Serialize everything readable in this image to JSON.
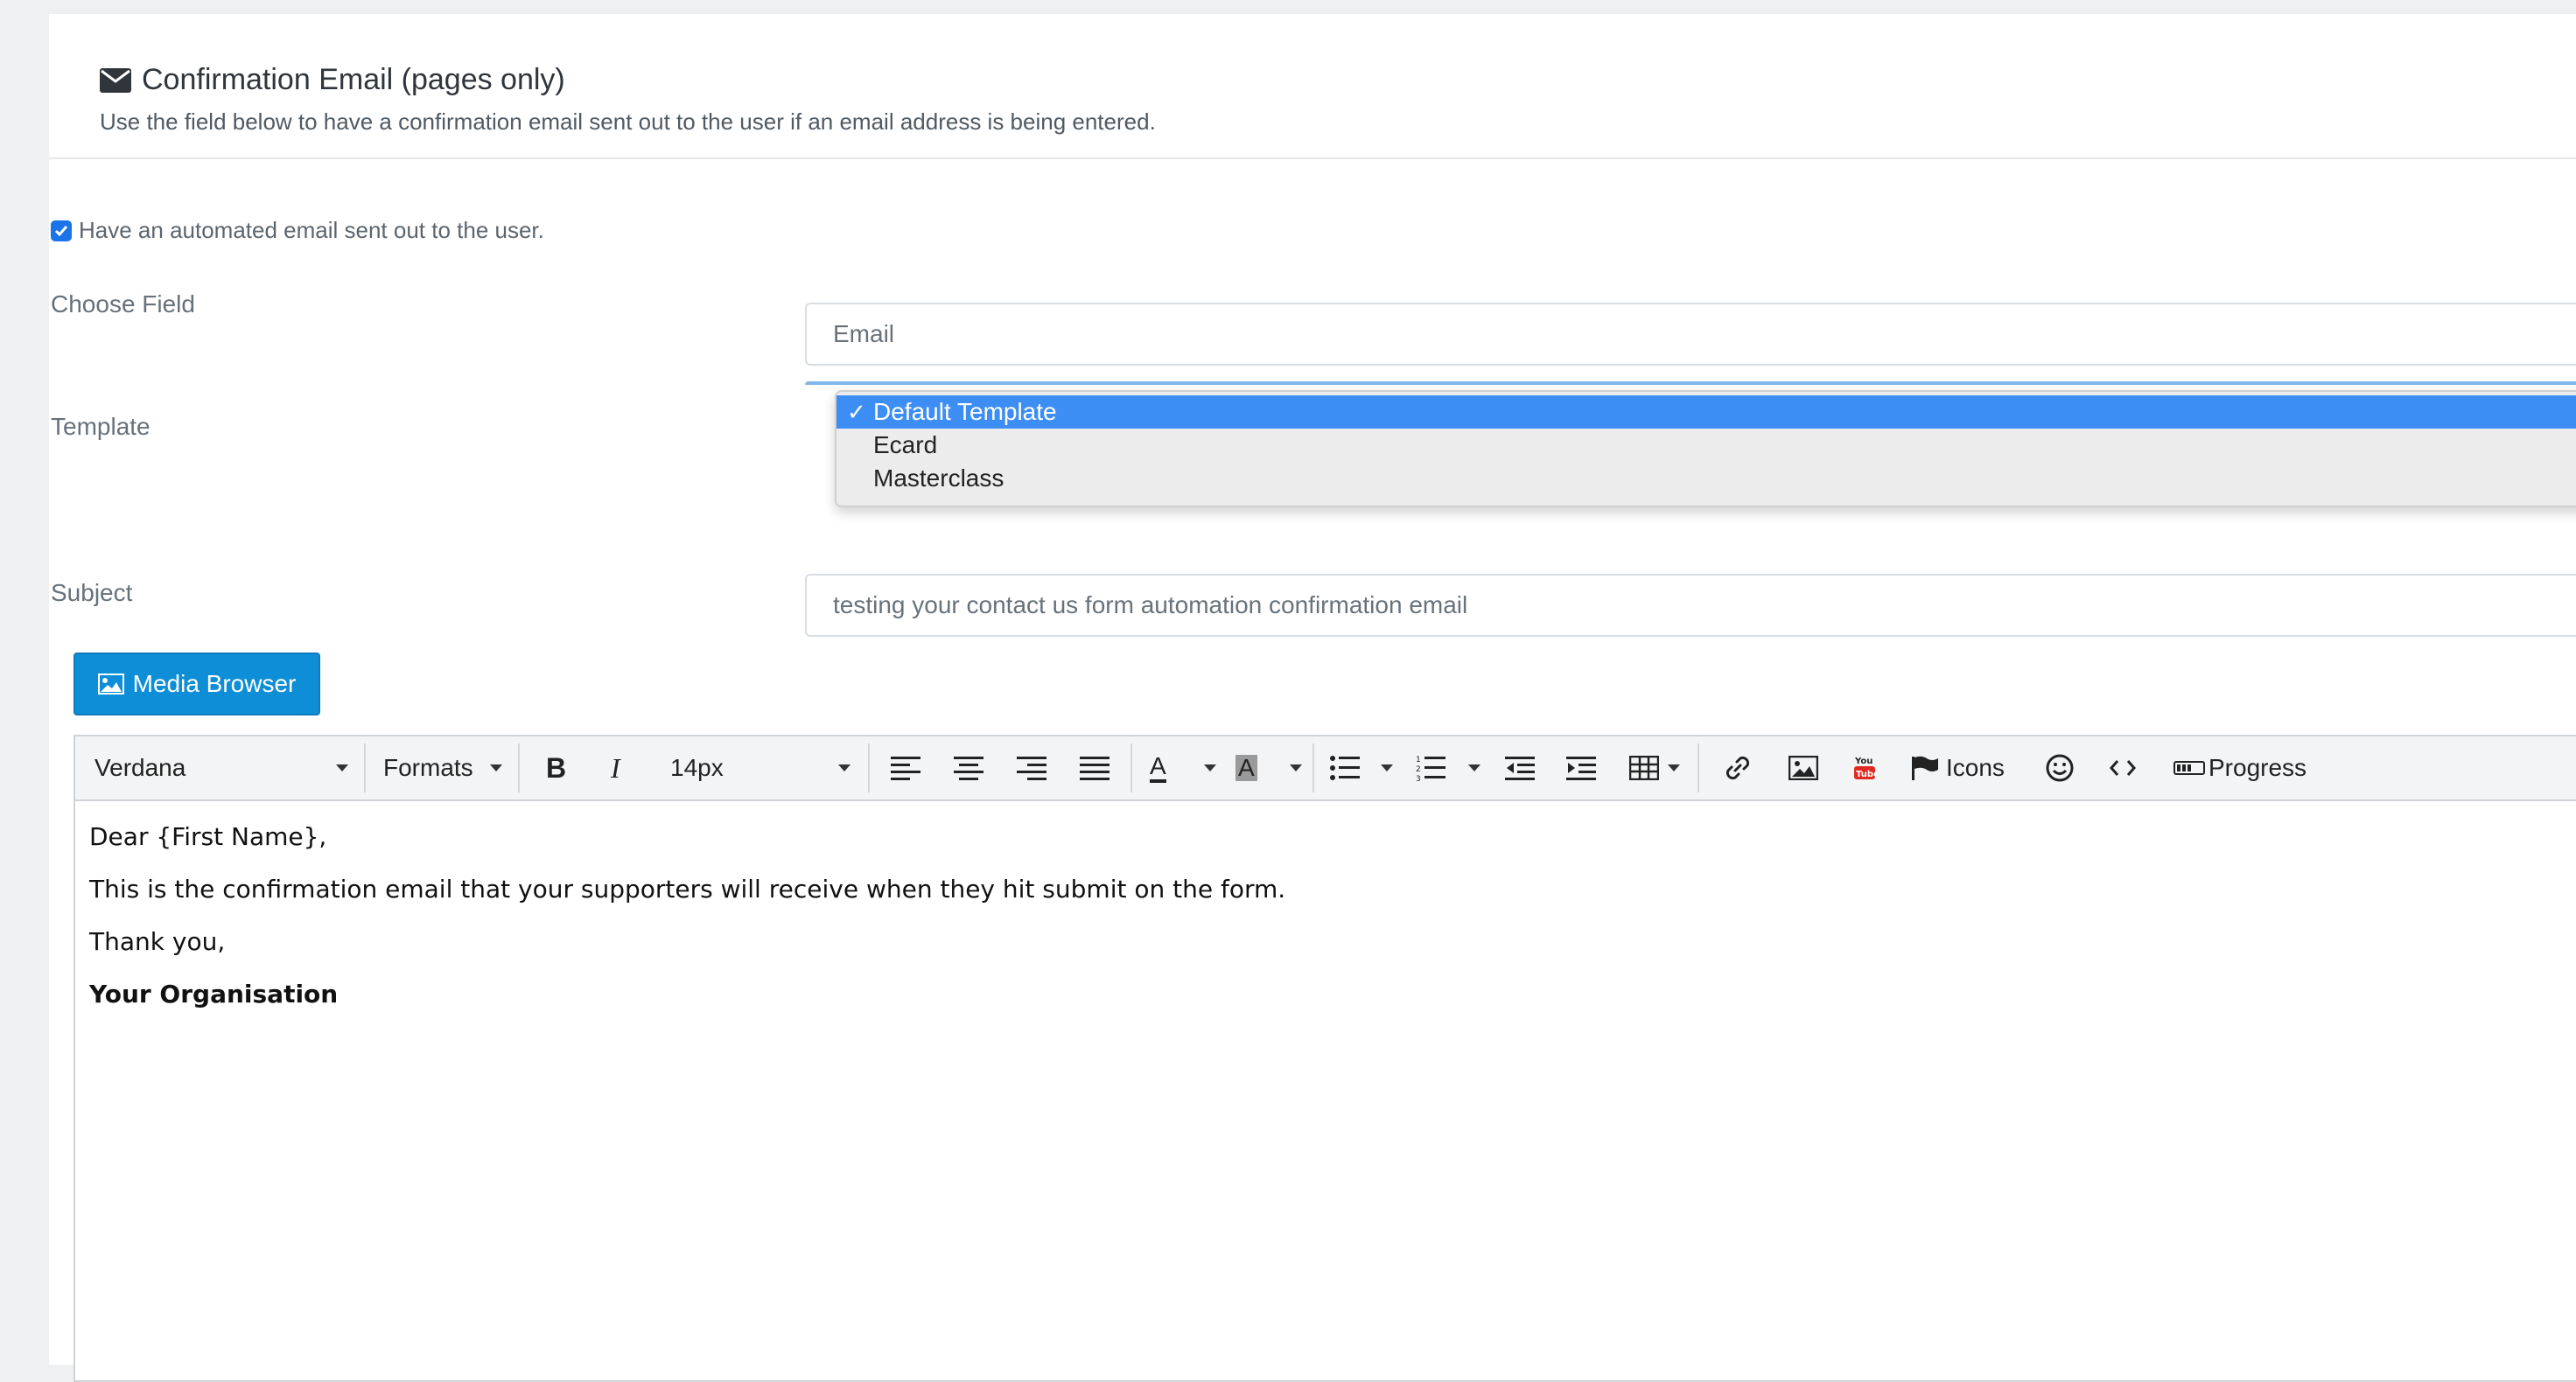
{
  "header": {
    "title": "Confirmation Email (pages only)",
    "subtitle": "Use the field below to have a confirmation email sent out to the user if an email address is being entered."
  },
  "form": {
    "auto_email_label": "Have an automated email sent out to the user.",
    "auto_email_checked": true,
    "choose_field_label": "Choose Field",
    "choose_field_value": "Email",
    "template_label": "Template",
    "template_options": [
      "Default Template",
      "Ecard",
      "Masterclass"
    ],
    "template_selected": "Default Template",
    "subject_label": "Subject",
    "subject_value": "testing your contact us form automation confirmation email"
  },
  "media_browser": {
    "label": "Media Browser"
  },
  "toolbar": {
    "font_family": "Verdana",
    "formats": "Formats",
    "font_size": "14px",
    "icons_label": "Icons",
    "progress_label": "Progress"
  },
  "editor": {
    "line1": "Dear {First Name},",
    "line2": "This is the confirmation email that your supporters will receive when they hit submit on the form.",
    "line3": "Thank you,",
    "line4": "Your Organisation"
  },
  "colors": {
    "accent": "#0d8ed6",
    "selected_option": "#3d8ef4",
    "checkbox": "#1a73e8"
  }
}
